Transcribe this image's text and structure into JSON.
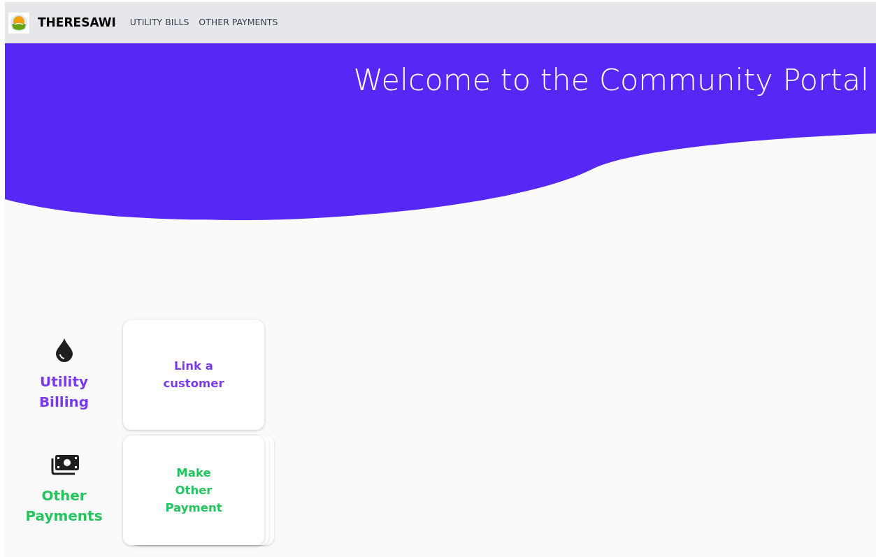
{
  "navbar": {
    "brand": "THERESAWI",
    "links": [
      {
        "label": "UTILITY BILLS"
      },
      {
        "label": "OTHER PAYMENTS"
      }
    ]
  },
  "hero": {
    "title": "Welcome to the Community Portal"
  },
  "sections": [
    {
      "kind": "water",
      "title": "Utility Billing",
      "color": "#7c3aed",
      "action": "Link a customer"
    },
    {
      "kind": "money",
      "title": "Other Payments",
      "color": "#22c55e",
      "action": "Make Other Payment"
    }
  ]
}
